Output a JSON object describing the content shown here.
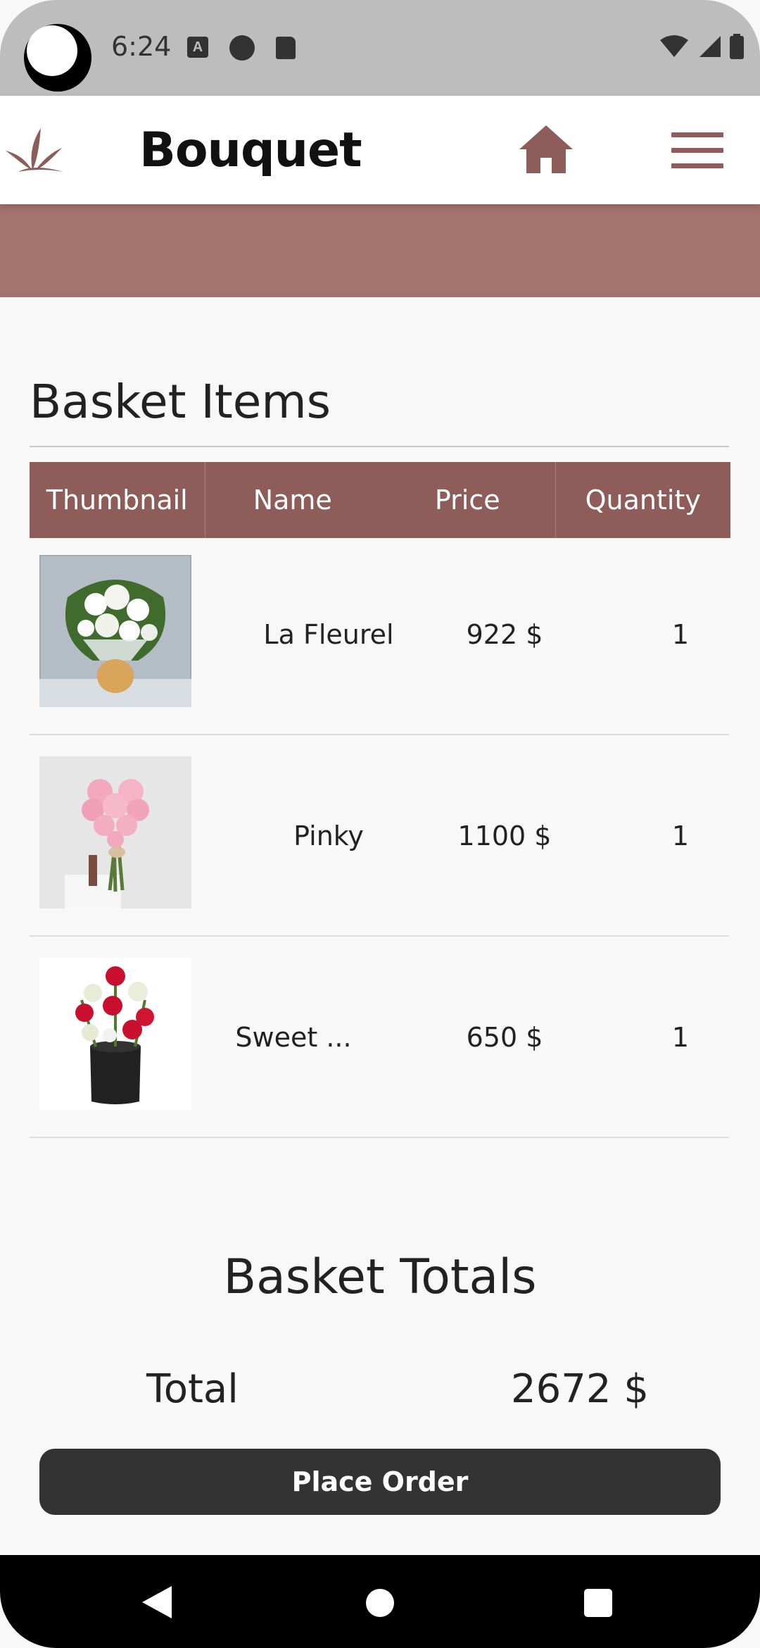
{
  "status_bar": {
    "time": "6:24",
    "icons": [
      "notification-a-icon",
      "circle-app-icon",
      "sd-card-icon",
      "wifi-icon",
      "signal-icon",
      "battery-icon"
    ],
    "notification_letter": "A"
  },
  "app_bar": {
    "title": "Bouquet",
    "logo_icon": "lotus-logo-icon",
    "home_icon": "home-icon",
    "menu_icon": "hamburger-menu-icon"
  },
  "colors": {
    "brand": "#8f5d59",
    "banner": "#a5736e",
    "button": "#333333",
    "background": "#f8f8f8"
  },
  "basket": {
    "title": "Basket Items",
    "columns": [
      "Thumbnail",
      "Name",
      "Price",
      "Quantity"
    ],
    "items": [
      {
        "name": "La Fleurel",
        "price": "922 $",
        "quantity": "1",
        "thumbnail": "white-lily-bouquet"
      },
      {
        "name": "Pinky",
        "price": "1100 $",
        "quantity": "1",
        "thumbnail": "pink-rose-heart-bouquet"
      },
      {
        "name": "Sweet ...",
        "price": "650 $",
        "quantity": "1",
        "thumbnail": "red-white-roses-box"
      }
    ]
  },
  "totals": {
    "title": "Basket Totals",
    "total_label": "Total",
    "total_value": "2672 $"
  },
  "actions": {
    "place_order": "Place Order"
  },
  "nav_bar": {
    "icons": [
      "back-icon",
      "home-circle-icon",
      "recents-icon"
    ]
  }
}
